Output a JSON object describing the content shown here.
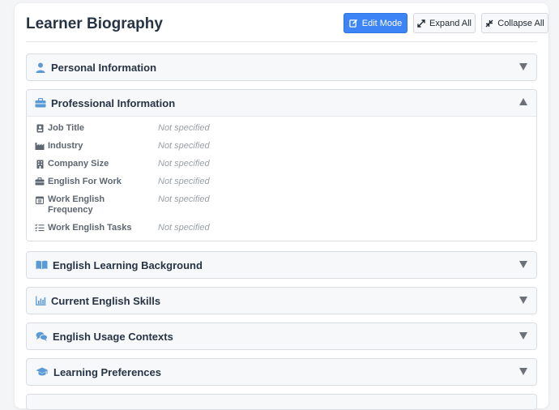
{
  "page": {
    "title": "Learner Biography"
  },
  "toolbar": {
    "edit_label": "Edit Mode",
    "expand_label": "Expand All",
    "collapse_label": "Collapse All"
  },
  "sections": [
    {
      "title": "Personal Information",
      "icon": "user-icon",
      "expanded": false
    },
    {
      "title": "Professional Information",
      "icon": "briefcase-icon",
      "expanded": true
    },
    {
      "title": "English Learning Background",
      "icon": "book-icon",
      "expanded": false
    },
    {
      "title": "Current English Skills",
      "icon": "bar-chart-icon",
      "expanded": false
    },
    {
      "title": "English Usage Contexts",
      "icon": "chat-bubbles-icon",
      "expanded": false
    },
    {
      "title": "Learning Preferences",
      "icon": "graduation-cap-icon",
      "expanded": false
    }
  ],
  "professional_fields": [
    {
      "label": "Job Title",
      "value": "Not specified",
      "icon": "id-badge-icon"
    },
    {
      "label": "Industry",
      "value": "Not specified",
      "icon": "industry-icon"
    },
    {
      "label": "Company Size",
      "value": "Not specified",
      "icon": "building-icon"
    },
    {
      "label": "English For Work",
      "value": "Not specified",
      "icon": "briefcase-icon"
    },
    {
      "label": "Work English Frequency",
      "value": "Not specified",
      "icon": "calendar-icon"
    },
    {
      "label": "Work English Tasks",
      "value": "Not specified",
      "icon": "task-list-icon"
    }
  ],
  "colors": {
    "accent": "#3d84f6",
    "icon_blue": "#5b9bd5",
    "heading": "#263445"
  }
}
